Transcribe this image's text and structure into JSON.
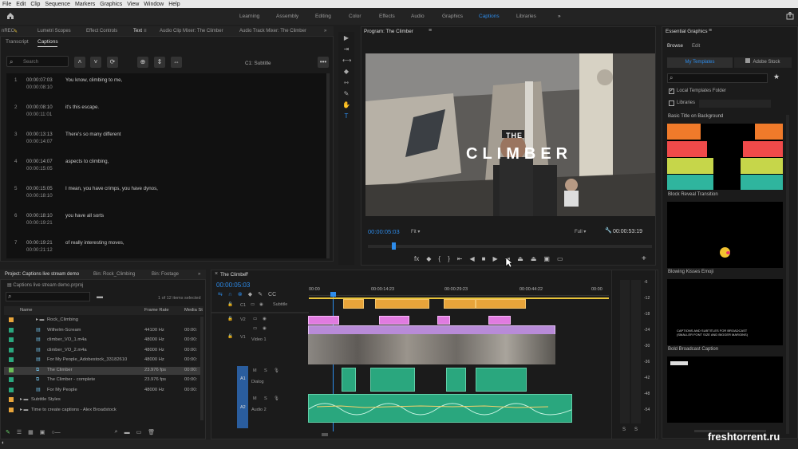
{
  "menu": [
    "File",
    "Edit",
    "Clip",
    "Sequence",
    "Markers",
    "Graphics",
    "View",
    "Window",
    "Help"
  ],
  "workspaces": [
    "Learning",
    "Assembly",
    "Editing",
    "Color",
    "Effects",
    "Audio",
    "Graphics",
    "Captions",
    "Libraries"
  ],
  "active_workspace": "Captions",
  "top_left_tabs": {
    "project_label": "nREC",
    "lumetri": "Lumetri Scopes",
    "effect_controls": "Effect Controls",
    "text": "Text",
    "clip_mixer": "Audio Clip Mixer: The Climber",
    "track_mixer": "Audio Track Mixer: The Climber"
  },
  "text_panel": {
    "tabs": [
      "Transcript",
      "Captions"
    ],
    "active_tab": "Captions",
    "search_placeholder": "Search",
    "track_label": "C1: Subtitle",
    "captions": [
      {
        "num": "1",
        "start": "00:00:07:03",
        "end": "00:00:08:10",
        "text": "You know, climbing to me,"
      },
      {
        "num": "2",
        "start": "00:00:08:10",
        "end": "00:00:11:01",
        "text": "it's this escape."
      },
      {
        "num": "3",
        "start": "00:00:13:13",
        "end": "00:00:14:07",
        "text": "There's so many different"
      },
      {
        "num": "4",
        "start": "00:00:14:07",
        "end": "00:00:15:05",
        "text": "aspects to climbing,"
      },
      {
        "num": "5",
        "start": "00:00:15:05",
        "end": "00:00:18:10",
        "text": "I mean, you have crimps, you have dynos,"
      },
      {
        "num": "6",
        "start": "00:00:18:10",
        "end": "00:00:19:21",
        "text": "you have all sorts"
      },
      {
        "num": "7",
        "start": "00:00:19:21",
        "end": "00:00:21:12",
        "text": "of really interesting moves,"
      }
    ]
  },
  "program_monitor": {
    "title": "Program: The Climber",
    "timecode": "00:00:05:03",
    "fit": "Fit",
    "quality": "Full",
    "duration": "00:00:53:19",
    "overlay_title_small": "THE",
    "overlay_title_big": "CLIMBER"
  },
  "essential_graphics": {
    "title": "Essential Graphics",
    "tabs": [
      "Browse",
      "Edit"
    ],
    "subtabs": [
      "My Templates",
      "Adobe Stock"
    ],
    "local_templates": "Local Templates Folder",
    "libraries": "Libraries",
    "templates": [
      {
        "name": "Basic Title on Background"
      },
      {
        "name": "Block Reveal Transition"
      },
      {
        "name": "Blowing Kisses Emoji"
      },
      {
        "name": "Bold Broadcast Caption",
        "preview_text": "CAPTIONS AND SUBTITLES FOR BROADCAST (SMALLER FONT SIZE AND BIGGER MARGINS)"
      }
    ]
  },
  "project_panel": {
    "tabs": [
      "Project: Captions live stream demo",
      "Bin: Rock_Climbing",
      "Bin: Footage"
    ],
    "project_file": "Captions live stream demo.prproj",
    "selection": "1 of 12 items selected",
    "columns": [
      "Name",
      "Frame Rate",
      "Media St"
    ],
    "items": [
      {
        "name": "Rock_Climbing",
        "rate": "",
        "start": "",
        "color": "#e8a43a",
        "kind": "folder"
      },
      {
        "name": "Wilhelm-Scream",
        "rate": "44100 Hz",
        "start": "00:00:",
        "color": "#2aa77e",
        "kind": "audio"
      },
      {
        "name": "climber_VO_1.m4a",
        "rate": "48000 Hz",
        "start": "00:00:",
        "color": "#2aa77e",
        "kind": "audio"
      },
      {
        "name": "climber_VO_2.m4a",
        "rate": "48000 Hz",
        "start": "00:00:",
        "color": "#2aa77e",
        "kind": "audio"
      },
      {
        "name": "For My People_Adobestock_33182610",
        "rate": "48000 Hz",
        "start": "00:00:",
        "color": "#2aa77e",
        "kind": "audio"
      },
      {
        "name": "The Climber",
        "rate": "23.976 fps",
        "start": "00:00:",
        "color": "#6bbf59",
        "kind": "sequence"
      },
      {
        "name": "The Climber - complete",
        "rate": "23.976 fps",
        "start": "00:00:",
        "color": "#2aa77e",
        "kind": "sequence"
      },
      {
        "name": "For My People",
        "rate": "48000 Hz",
        "start": "00:00:",
        "color": "#2aa77e",
        "kind": "audio"
      },
      {
        "name": "Subtitle Styles",
        "rate": "",
        "start": "",
        "color": "#e8a43a",
        "kind": "folder"
      },
      {
        "name": "Time to create captions - Alex Broadstock",
        "rate": "",
        "start": "",
        "color": "#e8a43a",
        "kind": "folder"
      }
    ]
  },
  "timeline": {
    "title": "The Climber",
    "timecode": "00:00:05:03",
    "ruler": [
      "00:00",
      "00:00:14:23",
      "00:00:29:23",
      "00:00:44:22",
      "00:00"
    ],
    "tracks": {
      "c1": "C1",
      "subtitle": "Subtitle",
      "v2": "V2",
      "v1": "V1",
      "video1": "Video 1",
      "a1": "A1",
      "dialog": "Dialog",
      "a2": "A2",
      "audio2": "Audio 2"
    },
    "meter_scale": [
      "-6",
      "-12",
      "-18",
      "-24",
      "-30",
      "-36",
      "-42",
      "-48",
      "-54"
    ],
    "meter_buttons": [
      "S",
      "S"
    ]
  },
  "watermark": "freshtorrent.ru"
}
